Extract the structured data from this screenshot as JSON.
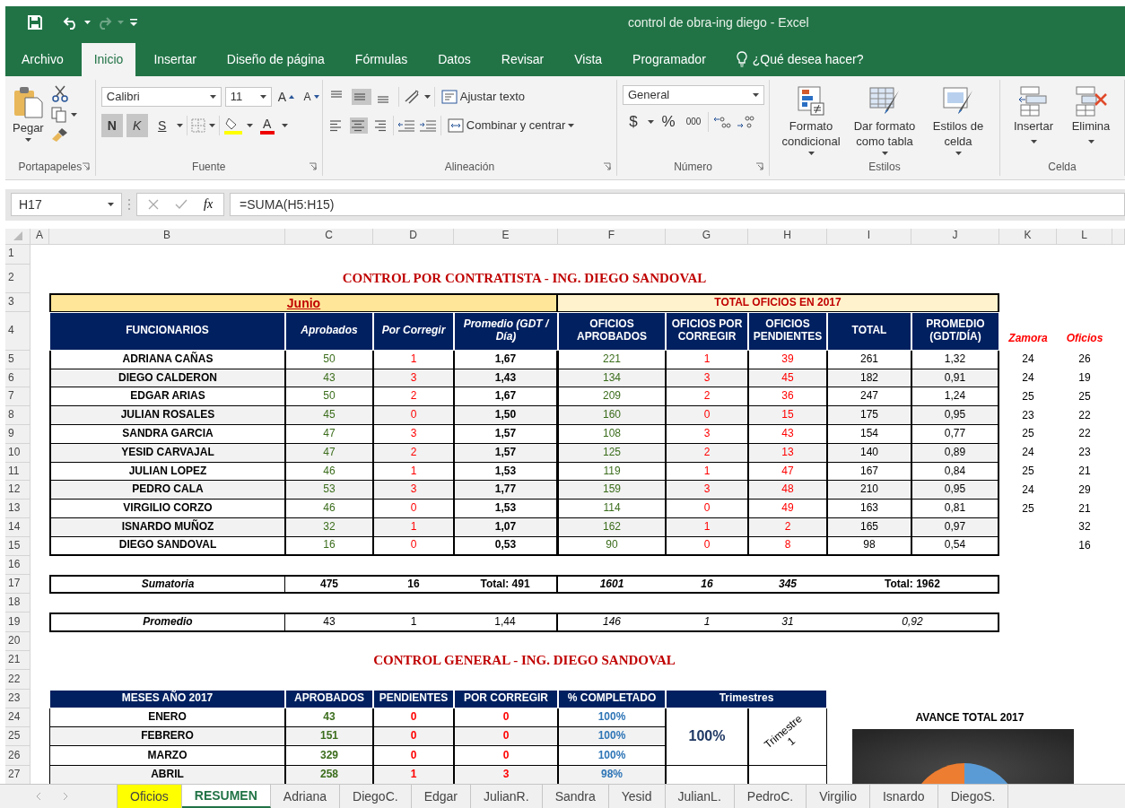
{
  "window": {
    "title": "control de obra-ing diego  -  Excel"
  },
  "ribbon_tabs": [
    {
      "label": "Archivo",
      "selected": false
    },
    {
      "label": "Inicio",
      "selected": true
    },
    {
      "label": "Insertar",
      "selected": false
    },
    {
      "label": "Diseño de página",
      "selected": false
    },
    {
      "label": "Fórmulas",
      "selected": false
    },
    {
      "label": "Datos",
      "selected": false
    },
    {
      "label": "Revisar",
      "selected": false
    },
    {
      "label": "Vista",
      "selected": false
    },
    {
      "label": "Programador",
      "selected": false
    }
  ],
  "tell_me": "¿Qué desea hacer?",
  "ribbon": {
    "groups": [
      {
        "kind": "clipboard",
        "label": "Portapapeles",
        "paste": "Pegar"
      },
      {
        "kind": "font",
        "label": "Fuente",
        "font": "Calibri",
        "size": "11",
        "grow": "A",
        "shrink": "A",
        "styles": [
          {
            "label": "N",
            "on": true
          },
          {
            "label": "K",
            "on": true
          },
          {
            "label": "S",
            "on": false
          }
        ],
        "font_color": "A"
      },
      {
        "kind": "alignment",
        "label": "Alineación",
        "vertical": [
          {
            "kind": "top",
            "on": false
          },
          {
            "kind": "middle",
            "on": true
          },
          {
            "kind": "bottom",
            "on": false
          }
        ],
        "horizontal": [
          {
            "kind": "left",
            "on": false
          },
          {
            "kind": "center",
            "on": true
          },
          {
            "kind": "right",
            "on": false
          }
        ],
        "wrap": "Ajustar texto",
        "merge": "Combinar y centrar"
      },
      {
        "kind": "number",
        "label": "Número",
        "format": "General",
        "currency": "$",
        "percent": "%",
        "thousands": "000"
      },
      {
        "kind": "styles",
        "label": "Estilos",
        "buttons": [
          "Formato condicional",
          "Dar formato como tabla",
          "Estilos de celda"
        ]
      },
      {
        "kind": "cells",
        "label": "Celda",
        "buttons": [
          "Insertar",
          "Elimina"
        ]
      }
    ]
  },
  "formula_bar": {
    "name_box": "H17",
    "function_label": "fx",
    "formula": "=SUMA(H5:H15)"
  },
  "column_headers": [
    "A",
    "B",
    "C",
    "D",
    "E",
    "F",
    "G",
    "H",
    "I",
    "J",
    "K",
    "L"
  ],
  "row_headers": [
    "1",
    "2",
    "3",
    "4",
    "5",
    "6",
    "7",
    "8",
    "9",
    "10",
    "11",
    "12",
    "13",
    "14",
    "15",
    "16",
    "17",
    "18",
    "19",
    "20",
    "21",
    "22",
    "23",
    "24",
    "25",
    "26",
    "27"
  ],
  "report": {
    "title": "CONTROL POR CONTRATISTA - ING. DIEGO SANDOVAL",
    "month_header": "Junio",
    "year_header": "TOTAL OFICIOS EN 2017",
    "columns": [
      "FUNCIONARIOS",
      "Aprobados",
      "Por Corregir",
      "Promedio (GDT / Día)",
      "OFICIOS APROBADOS",
      "OFICIOS POR CORREGIR",
      "OFICIOS PENDIENTES",
      "TOTAL",
      "PROMEDIO (GDT/DÍA)",
      "Zamora",
      "Oficios"
    ],
    "rows": [
      {
        "name": "ADRIANA CAÑAS",
        "aprobados": "50",
        "por_corregir": "1",
        "promedio": "1,67",
        "oficios_aprobados": "221",
        "oficios_por_corregir": "1",
        "oficios_pendientes": "39",
        "total": "261",
        "promedio_gdt": "1,32",
        "zamora": "24",
        "oficios": "26"
      },
      {
        "name": "DIEGO CALDERON",
        "aprobados": "43",
        "por_corregir": "3",
        "promedio": "1,43",
        "oficios_aprobados": "134",
        "oficios_por_corregir": "3",
        "oficios_pendientes": "45",
        "total": "182",
        "promedio_gdt": "0,91",
        "zamora": "24",
        "oficios": "19"
      },
      {
        "name": "EDGAR ARIAS",
        "aprobados": "50",
        "por_corregir": "2",
        "promedio": "1,67",
        "oficios_aprobados": "209",
        "oficios_por_corregir": "2",
        "oficios_pendientes": "36",
        "total": "247",
        "promedio_gdt": "1,24",
        "zamora": "25",
        "oficios": "25"
      },
      {
        "name": "JULIAN ROSALES",
        "aprobados": "45",
        "por_corregir": "0",
        "promedio": "1,50",
        "oficios_aprobados": "160",
        "oficios_por_corregir": "0",
        "oficios_pendientes": "15",
        "total": "175",
        "promedio_gdt": "0,95",
        "zamora": "23",
        "oficios": "22"
      },
      {
        "name": "SANDRA GARCIA",
        "aprobados": "47",
        "por_corregir": "3",
        "promedio": "1,57",
        "oficios_aprobados": "108",
        "oficios_por_corregir": "3",
        "oficios_pendientes": "43",
        "total": "154",
        "promedio_gdt": "0,77",
        "zamora": "25",
        "oficios": "22"
      },
      {
        "name": "YESID CARVAJAL",
        "aprobados": "47",
        "por_corregir": "2",
        "promedio": "1,57",
        "oficios_aprobados": "125",
        "oficios_por_corregir": "2",
        "oficios_pendientes": "13",
        "total": "140",
        "promedio_gdt": "0,89",
        "zamora": "24",
        "oficios": "23"
      },
      {
        "name": "JULIAN LOPEZ",
        "aprobados": "46",
        "por_corregir": "1",
        "promedio": "1,53",
        "oficios_aprobados": "119",
        "oficios_por_corregir": "1",
        "oficios_pendientes": "47",
        "total": "167",
        "promedio_gdt": "0,84",
        "zamora": "25",
        "oficios": "21"
      },
      {
        "name": "PEDRO CALA",
        "aprobados": "53",
        "por_corregir": "3",
        "promedio": "1,77",
        "oficios_aprobados": "159",
        "oficios_por_corregir": "3",
        "oficios_pendientes": "48",
        "total": "210",
        "promedio_gdt": "0,95",
        "zamora": "24",
        "oficios": "29"
      },
      {
        "name": "VIRGILIO CORZO",
        "aprobados": "46",
        "por_corregir": "0",
        "promedio": "1,53",
        "oficios_aprobados": "114",
        "oficios_por_corregir": "0",
        "oficios_pendientes": "49",
        "total": "163",
        "promedio_gdt": "0,81",
        "zamora": "25",
        "oficios": "21"
      },
      {
        "name": "ISNARDO MUÑOZ",
        "aprobados": "32",
        "por_corregir": "1",
        "promedio": "1,07",
        "oficios_aprobados": "162",
        "oficios_por_corregir": "1",
        "oficios_pendientes": "2",
        "total": "165",
        "promedio_gdt": "0,97",
        "oficios": "32"
      },
      {
        "name": "DIEGO SANDOVAL",
        "aprobados": "16",
        "por_corregir": "0",
        "promedio": "0,53",
        "oficios_aprobados": "90",
        "oficios_por_corregir": "0",
        "oficios_pendientes": "8",
        "total": "98",
        "promedio_gdt": "0,54",
        "oficios": "16"
      }
    ],
    "sum_row": {
      "label": "Sumatoria",
      "aprobados": "475",
      "por_corregir": "16",
      "promedio": "Total: 491",
      "oficios_aprobados": "1601",
      "oficios_por_corregir": "16",
      "oficios_pendientes": "345",
      "total": "Total: 1962"
    },
    "avg_row": {
      "label": "Promedio",
      "aprobados": "43",
      "por_corregir": "1",
      "promedio": "1,44",
      "oficios_aprobados": "146",
      "oficios_por_corregir": "1",
      "oficios_pendientes": "31",
      "total": "0,92"
    }
  },
  "general": {
    "title": "CONTROL GENERAL - ING. DIEGO SANDOVAL",
    "columns": [
      "MESES AÑO 2017",
      "APROBADOS",
      "PENDIENTES",
      "POR CORREGIR",
      "% COMPLETADO",
      "Trimestres"
    ],
    "rows": [
      {
        "month": "ENERO",
        "aprobados": "43",
        "pendientes": "0",
        "por_corregir": "0",
        "completado": "100%"
      },
      {
        "month": "FEBRERO",
        "aprobados": "151",
        "pendientes": "0",
        "por_corregir": "0",
        "completado": "100%"
      },
      {
        "month": "MARZO",
        "aprobados": "329",
        "pendientes": "0",
        "por_corregir": "0",
        "completado": "100%"
      },
      {
        "month": "ABRIL",
        "aprobados": "258",
        "pendientes": "1",
        "por_corregir": "3",
        "completado": "98%"
      }
    ],
    "quarters": [
      {
        "value": "100%",
        "label": "Trimestre 1"
      }
    ]
  },
  "chart": {
    "title": "AVANCE TOTAL 2017"
  },
  "sheet_tabs": [
    {
      "label": "Oficios",
      "selected": false,
      "color": "#ffff00"
    },
    {
      "label": "RESUMEN",
      "selected": true
    },
    {
      "label": "Adriana",
      "selected": false
    },
    {
      "label": "DiegoC.",
      "selected": false
    },
    {
      "label": "Edgar",
      "selected": false
    },
    {
      "label": "JulianR.",
      "selected": false
    },
    {
      "label": "Sandra",
      "selected": false
    },
    {
      "label": "Yesid",
      "selected": false
    },
    {
      "label": "JulianL.",
      "selected": false
    },
    {
      "label": "PedroC.",
      "selected": false
    },
    {
      "label": "Virgilio",
      "selected": false
    },
    {
      "label": "Isnardo",
      "selected": false
    },
    {
      "label": "DiegoS.",
      "selected": false
    }
  ]
}
